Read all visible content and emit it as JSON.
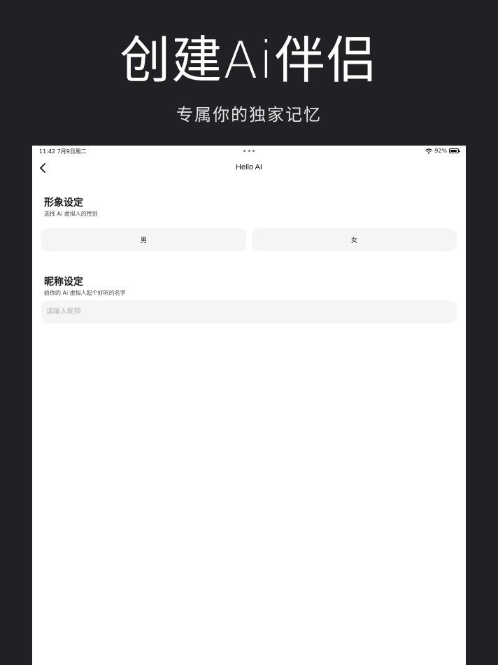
{
  "hero": {
    "title": "创建Ai伴侣",
    "subtitle": "专属你的独家记忆"
  },
  "status_bar": {
    "time": "11:42  7月9日周二",
    "battery": "92%",
    "icons": [
      "wifi-icon",
      "battery-icon"
    ]
  },
  "nav": {
    "title": "Hello AI",
    "back_icon": "chevron-left-icon"
  },
  "appearance": {
    "title": "形象设定",
    "desc": "选择 Ai 虚拟人的性别",
    "options": [
      "男",
      "女"
    ]
  },
  "nickname": {
    "title": "昵称设定",
    "desc": "给你的 Ai 虚拟人起个好听的名字",
    "placeholder": "请输入昵称",
    "value": ""
  }
}
